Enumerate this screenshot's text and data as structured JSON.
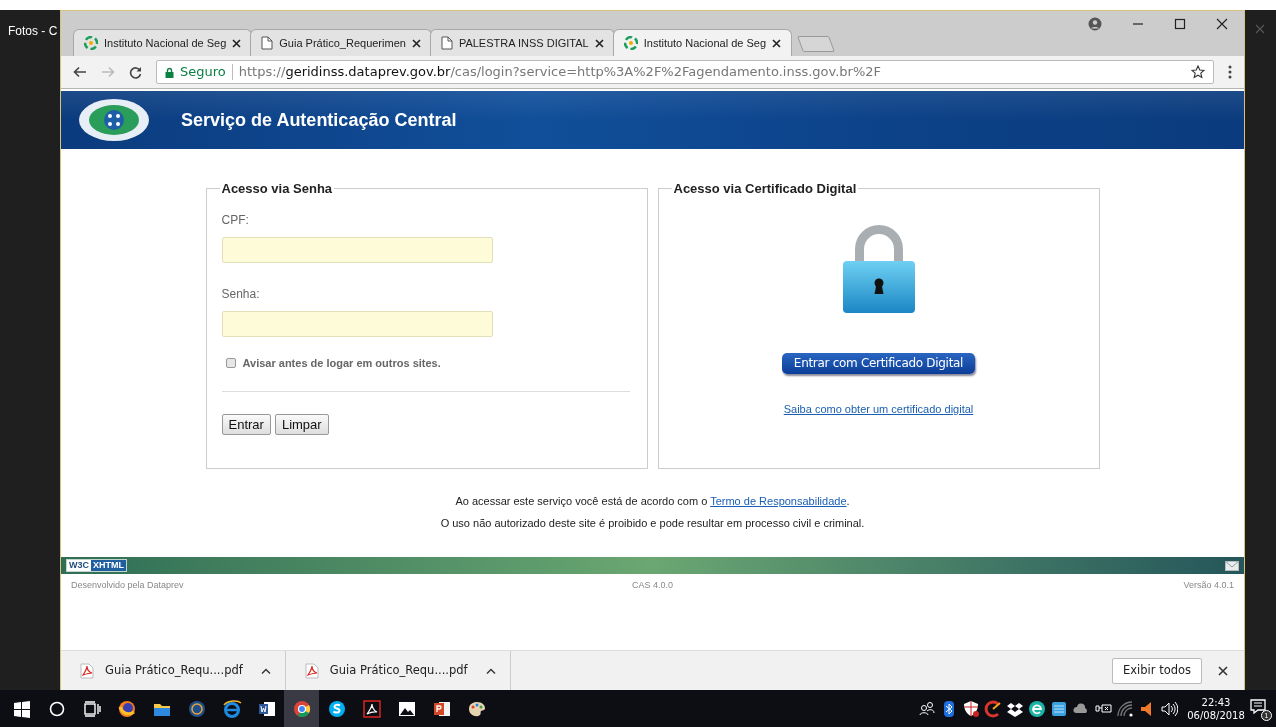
{
  "app_frame": {
    "title": "Fotos - C"
  },
  "tabs": [
    {
      "title": "Instituto Nacional de Seg",
      "kind": "site",
      "selected": false
    },
    {
      "title": "Guia Prático_Requerimen",
      "kind": "document",
      "selected": false
    },
    {
      "title": "PALESTRA INSS DIGITAL",
      "kind": "document",
      "selected": false
    },
    {
      "title": "Instituto Nacional de Seg",
      "kind": "site",
      "selected": true
    }
  ],
  "address_bar": {
    "security": "Seguro",
    "url": "https://**geridinss.dataprev.gov.br**/cas/login?service=http%3A%2F%2Fagendamento.inss.gov.br%2F"
  },
  "header": {
    "title": "Serviço de Autenticação Central"
  },
  "password_panel": {
    "legend": "Acesso via Senha",
    "cpf_label": "CPF:",
    "password_label": "Senha:",
    "remember": {
      "label": "Avisar antes de logar em outros sites.",
      "checked": false
    },
    "buttons": [
      "Entrar",
      "Limpar"
    ]
  },
  "certificate_panel": {
    "legend": "Acesso via Certificado Digital",
    "button": "Entrar com Certificado Digital",
    "link": "Saiba como obter um certificado digital"
  },
  "notice": {
    "before": "Ao acessar este serviço você está de acordo com o ",
    "link": "Termo de Responsabilidade",
    "after": ".",
    "line2": "O uso não autorizado deste site é proibido e pode resultar em processo civil e criminal."
  },
  "footer": {
    "badge_left": "W3C",
    "badge_right": "XHTML",
    "developer": "Desenvolvido pela Dataprev",
    "center": "CAS 4.0.0",
    "version": "Versão 4.0.1"
  },
  "downloads": {
    "items": [
      {
        "file": "Guia Prático_Requ....pdf"
      },
      {
        "file": "Guia Prático_Requ....pdf"
      }
    ],
    "show_all": "Exibir todos"
  },
  "taskbar": {
    "apps": [
      {
        "active": false
      },
      {
        "active": false
      },
      {
        "active": false
      },
      {
        "active": false
      },
      {
        "active": false
      },
      {
        "active": false
      },
      {
        "active": true
      },
      {
        "active": false
      },
      {
        "active": false
      },
      {
        "active": false
      },
      {
        "active": false
      },
      {
        "active": false
      }
    ],
    "time": "22:43",
    "date": "06/08/2018",
    "notifications": "1"
  }
}
